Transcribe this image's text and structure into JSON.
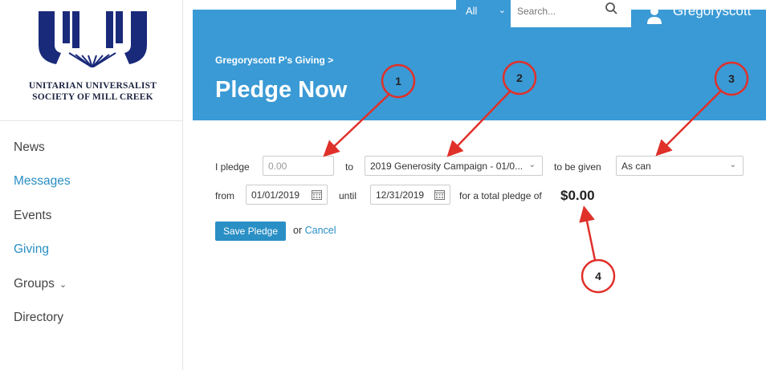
{
  "sidebar": {
    "logo_text_line1": "UNITARIAN UNIVERSALIST",
    "logo_text_line2": "SOCIETY OF MILL CREEK",
    "items": [
      {
        "label": "News"
      },
      {
        "label": "Messages"
      },
      {
        "label": "Events"
      },
      {
        "label": "Giving"
      },
      {
        "label": "Groups"
      },
      {
        "label": "Directory"
      }
    ]
  },
  "header": {
    "search_scope": "All",
    "search_placeholder": "Search...",
    "username": "Gregoryscott",
    "breadcrumb": "Gregoryscott P's Giving >",
    "title": "Pledge Now"
  },
  "form": {
    "pledge_label": "I pledge",
    "pledge_placeholder": "0.00",
    "to_label": "to",
    "campaign_value": "2019 Generosity Campaign - 01/0...",
    "given_label": "to be given",
    "frequency_value": "As can",
    "from_label": "from",
    "from_date": "01/01/2019",
    "until_label": "until",
    "until_date": "12/31/2019",
    "total_label": "for a total pledge of",
    "total_value": "$0.00",
    "save_label": "Save Pledge",
    "or_label": "or",
    "cancel_label": "Cancel"
  },
  "annotations": {
    "color": "#e0302a",
    "callouts": [
      "1",
      "2",
      "3",
      "4"
    ]
  },
  "colors": {
    "banner": "#3a9ad5",
    "accent": "#2a8fc5",
    "annotation": "#e0302a"
  }
}
